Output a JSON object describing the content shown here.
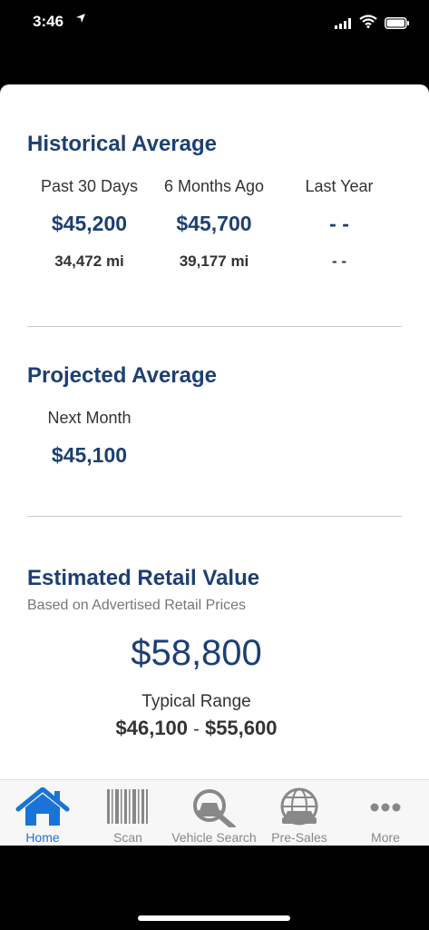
{
  "status_bar": {
    "time": "3:46"
  },
  "historical": {
    "title": "Historical Average",
    "columns": [
      {
        "label": "Past 30 Days",
        "price": "$45,200",
        "mileage": "34,472 mi"
      },
      {
        "label": "6 Months Ago",
        "price": "$45,700",
        "mileage": "39,177 mi"
      },
      {
        "label": "Last Year",
        "price": "- -",
        "mileage": "- -"
      }
    ]
  },
  "projected": {
    "title": "Projected Average",
    "label": "Next Month",
    "price": "$45,100"
  },
  "retail": {
    "title": "Estimated Retail Value",
    "subtitle": "Based on Advertised Retail Prices",
    "value": "$58,800",
    "range_label": "Typical Range",
    "range_low": "$46,100",
    "range_sep": "-",
    "range_high": "$55,600"
  },
  "tabs": [
    {
      "label": "Home",
      "icon": "home-icon",
      "active": true
    },
    {
      "label": "Scan",
      "icon": "barcode-icon",
      "active": false
    },
    {
      "label": "Vehicle Search",
      "icon": "vehicle-search-icon",
      "active": false
    },
    {
      "label": "Pre-Sales",
      "icon": "globe-car-icon",
      "active": false
    },
    {
      "label": "More",
      "icon": "more-icon",
      "active": false
    }
  ],
  "colors": {
    "accent": "#1d3f73",
    "tab_active": "#1a73d6",
    "tab_inactive": "#888888"
  }
}
